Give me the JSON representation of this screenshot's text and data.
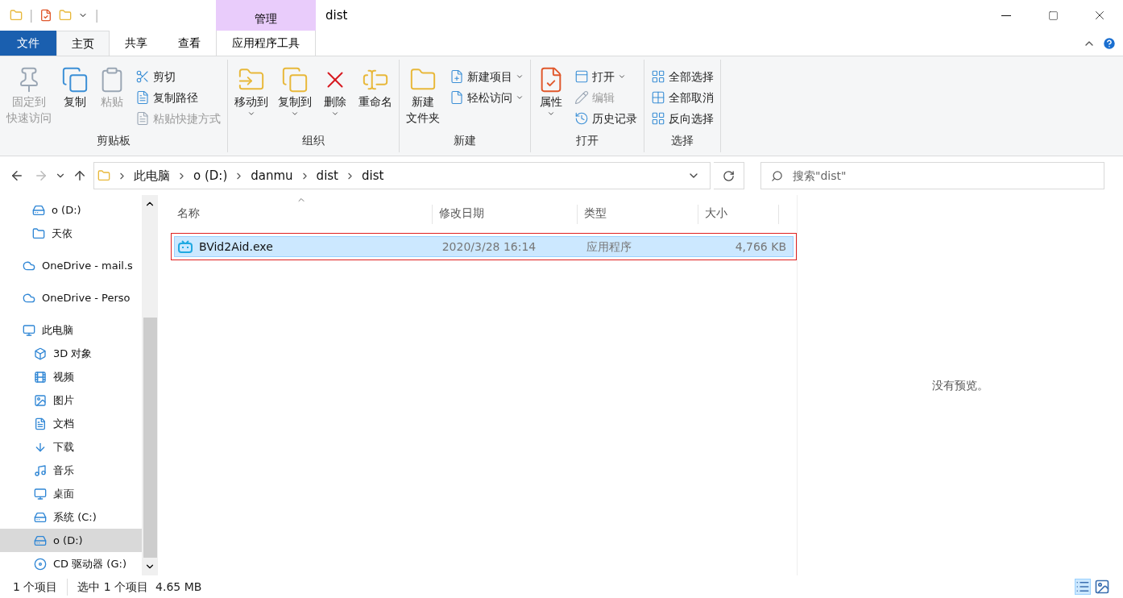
{
  "window": {
    "title": "dist",
    "context_tab": {
      "label": "管理"
    }
  },
  "quick_access": {
    "separator": "|"
  },
  "tabs": [
    {
      "label": "文件",
      "selected": false,
      "kind": "file"
    },
    {
      "label": "主页",
      "selected": true,
      "kind": "tab"
    },
    {
      "label": "共享",
      "selected": false,
      "kind": "tab"
    },
    {
      "label": "查看",
      "selected": false,
      "kind": "tab"
    },
    {
      "label": "应用程序工具",
      "selected": false,
      "kind": "context"
    }
  ],
  "ribbon": [
    {
      "label": "剪贴板",
      "commands": [
        {
          "lines": [
            "固定到",
            "快速访问"
          ],
          "kind": "large",
          "disabled": true,
          "dropdown": false
        },
        {
          "label": "复制",
          "kind": "large",
          "disabled": false,
          "dropdown": false
        },
        {
          "label": "粘贴",
          "kind": "large",
          "disabled": true,
          "dropdown": false
        },
        {
          "label": "剪切",
          "kind": "small",
          "disabled": false,
          "dropdown": false
        },
        {
          "label": "复制路径",
          "kind": "small",
          "disabled": false,
          "dropdown": false
        },
        {
          "label": "粘贴快捷方式",
          "kind": "small",
          "disabled": true,
          "dropdown": false
        }
      ]
    },
    {
      "label": "组织",
      "commands": [
        {
          "label": "移动到",
          "kind": "large",
          "disabled": false,
          "dropdown": true
        },
        {
          "label": "复制到",
          "kind": "large",
          "disabled": false,
          "dropdown": true
        },
        {
          "label": "删除",
          "kind": "large",
          "disabled": false,
          "dropdown": true
        },
        {
          "label": "重命名",
          "kind": "large",
          "disabled": false,
          "dropdown": false
        }
      ]
    },
    {
      "label": "新建",
      "commands": [
        {
          "lines": [
            "新建",
            "文件夹"
          ],
          "kind": "large",
          "disabled": false,
          "dropdown": false
        },
        {
          "label": "新建项目",
          "kind": "small",
          "disabled": false,
          "dropdown": true
        },
        {
          "label": "轻松访问",
          "kind": "small",
          "disabled": false,
          "dropdown": true
        }
      ]
    },
    {
      "label": "打开",
      "commands": [
        {
          "label": "属性",
          "kind": "large",
          "disabled": false,
          "dropdown": true
        },
        {
          "label": "打开",
          "kind": "small",
          "disabled": false,
          "dropdown": true
        },
        {
          "label": "编辑",
          "kind": "small",
          "disabled": true,
          "dropdown": false
        },
        {
          "label": "历史记录",
          "kind": "small",
          "disabled": false,
          "dropdown": false
        }
      ]
    },
    {
      "label": "选择",
      "commands": [
        {
          "label": "全部选择",
          "kind": "small",
          "disabled": false,
          "dropdown": false
        },
        {
          "label": "全部取消",
          "kind": "small",
          "disabled": false,
          "dropdown": false
        },
        {
          "label": "反向选择",
          "kind": "small",
          "disabled": false,
          "dropdown": false
        }
      ]
    }
  ],
  "address_bar": {
    "path": [
      "此电脑",
      "o (D:)",
      "danmu",
      "dist",
      "dist"
    ]
  },
  "search": {
    "placeholder": "搜索\"dist\""
  },
  "sidebar": {
    "items": [
      {
        "label": "o (D:)",
        "selected": false,
        "group": false
      },
      {
        "label": "天依",
        "selected": false,
        "group": false
      },
      {
        "label": "OneDrive - mail.s",
        "selected": false,
        "group": true
      },
      {
        "label": "OneDrive - Perso",
        "selected": false,
        "group": true
      },
      {
        "label": "此电脑",
        "selected": false,
        "group": true,
        "children": [
          {
            "label": "3D 对象",
            "selected": false
          },
          {
            "label": "视频",
            "selected": false
          },
          {
            "label": "图片",
            "selected": false
          },
          {
            "label": "文档",
            "selected": false
          },
          {
            "label": "下载",
            "selected": false
          },
          {
            "label": "音乐",
            "selected": false
          },
          {
            "label": "桌面",
            "selected": false
          },
          {
            "label": "系统 (C:)",
            "selected": false
          },
          {
            "label": "o (D:)",
            "selected": true
          },
          {
            "label": "CD 驱动器 (G:)",
            "selected": false
          }
        ]
      }
    ]
  },
  "table": {
    "columns": [
      "名称",
      "修改日期",
      "类型",
      "大小"
    ],
    "rows": [
      {
        "name": "BVid2Aid.exe",
        "modified": "2020/3/28 16:14",
        "type": "应用程序",
        "size": "4,766 KB",
        "selected": true,
        "outlined": true
      }
    ]
  },
  "preview": {
    "text": "没有预览。"
  },
  "status_bar": {
    "items": [
      "1 个项目",
      "选中 1 个项目  4.65 MB"
    ]
  }
}
